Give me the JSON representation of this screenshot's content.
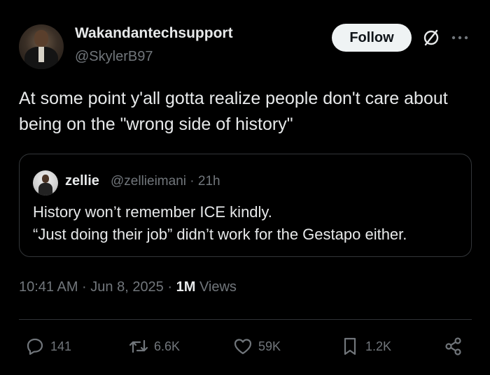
{
  "author": {
    "display_name": "Wakandantechsupport",
    "handle": "@SkylerB97"
  },
  "header": {
    "follow_label": "Follow",
    "grok_icon": "slashed-circle-icon",
    "more_icon": "more-dots-icon"
  },
  "tweet": {
    "text": "At some point y'all gotta realize people don't care about being on the \"wrong side of history\""
  },
  "quote": {
    "display_name": "zellie",
    "meta": "@zellieimani · 21h",
    "line1": "History won’t remember ICE kindly.",
    "line2": "“Just doing their job” didn’t work for the Gestapo either."
  },
  "timestamp": {
    "time_date": "10:41 AM · Jun 8, 2025 · ",
    "views_count": "1M",
    "views_label": " Views"
  },
  "actions": {
    "replies": "141",
    "reposts": "6.6K",
    "likes": "59K",
    "bookmarks": "1.2K"
  },
  "colors": {
    "background": "#000000",
    "text_primary": "#e7e9ea",
    "text_secondary": "#71767b",
    "border": "#333639",
    "follow_bg": "#eff3f4"
  }
}
